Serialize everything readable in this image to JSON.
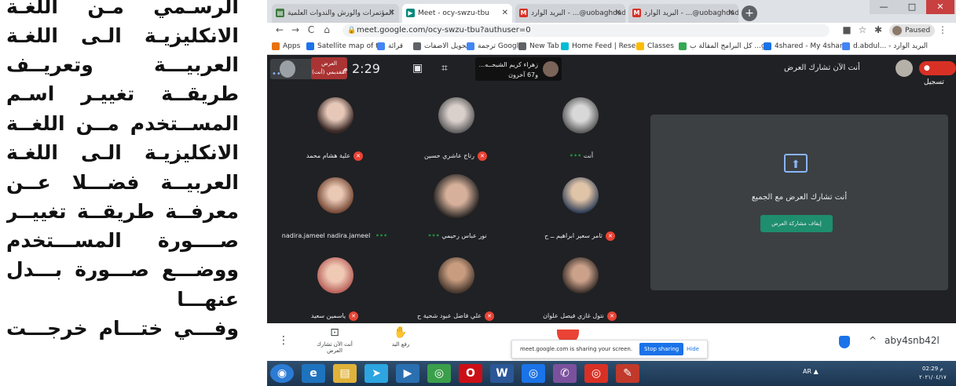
{
  "document": {
    "lines": [
      "الرسـمي مـن اللغـة",
      "الانكليزيـة الـى اللغـة",
      "العربيـــة وتعريــف",
      "طريقــة تغييـر اسـم",
      "المســتخدم مــن اللغــة",
      "الانكليزيـة الـى اللغـة",
      "العربيــة فضـــلا عــن",
      "معرفــة طريقــة تغييــر",
      "صــــورة المســـتخدم",
      "ووضـــع صـــورة بـــدل",
      "عنهـــا",
      "وفـــي ختـــام خرجـــت"
    ]
  },
  "browser": {
    "tabs": [
      {
        "title": "البريد الوارد - ...@uobaghdad.edu.iq",
        "favicon": "gmail-icon",
        "color": "#d93025"
      },
      {
        "title": "البريد الوارد - ...@uobaghdad.edu.iq",
        "favicon": "gmail-icon",
        "color": "#d93025"
      },
      {
        "title": "Meet - ocy-swzu-tbu",
        "favicon": "meet-icon",
        "color": "#00897b"
      },
      {
        "title": "المؤتمرات والورش والندوات العلمية",
        "favicon": "page-icon",
        "color": "#1a73e8"
      }
    ],
    "window_controls": {
      "minimize": "—",
      "maximize": "□",
      "close": "✕"
    },
    "nav": {
      "back": "←",
      "forward": "→",
      "reload": "C",
      "home": "⌂"
    },
    "url": "meet.google.com/ocy-swzu-tbu?authuser=0",
    "paused_label": "Paused",
    "bookmarks": [
      {
        "label": "Apps",
        "color": "#e8710a"
      },
      {
        "label": "Satellite map of the...",
        "color": "#1a73e8"
      },
      {
        "label": "قرائة",
        "color": "#4285f4"
      },
      {
        "label": "تحويل الاضفات",
        "color": "#5f6368"
      },
      {
        "label": "ترجمة Google",
        "color": "#4285f4"
      },
      {
        "label": "New Tab",
        "color": "#5f6368"
      },
      {
        "label": "Home Feed | Resea...",
        "color": "#00bcd4"
      },
      {
        "label": "Classes",
        "color": "#fbbc04"
      },
      {
        "label": "كل البرامج المقالة ب ...gis",
        "color": "#34a853"
      },
      {
        "label": "4shared - My 4shar...",
        "color": "#1a73e8"
      },
      {
        "label": "d.abdul... - البريد الوارد",
        "color": "#4285f4"
      }
    ]
  },
  "meet": {
    "self_tile_label": "أنت",
    "presenting_badge": "العرض التقديمي (أنت)",
    "time": "2:29",
    "time_suffix": "م",
    "speaker": "زهراء كريم الشبحــه... و67 آخرون",
    "you_presenting": "أنت الآن تشارك العرض",
    "record_label": "تسجيل",
    "participants": [
      {
        "name": "أنت",
        "muted": false,
        "speaking": true,
        "photo": "g9"
      },
      {
        "name": "رتاج عاشري حسين",
        "muted": true,
        "speaking": false,
        "photo": "g2"
      },
      {
        "name": "علية هشام محمد",
        "muted": true,
        "speaking": false,
        "photo": "g1"
      },
      {
        "name": "ثامر سعير ابراهيم ــ ح",
        "muted": true,
        "speaking": false,
        "photo": "g3"
      },
      {
        "name": "نور عباس رحيمي",
        "muted": false,
        "speaking": true,
        "photo": "g5"
      },
      {
        "name": "nadira.jameel nadira.jameel",
        "muted": false,
        "speaking": true,
        "photo": "g4"
      },
      {
        "name": "نتول غازي فيصل علوان",
        "muted": true,
        "speaking": false,
        "photo": "g8"
      },
      {
        "name": "علي فاضل عبود شحية ح",
        "muted": true,
        "speaking": false,
        "photo": "g6"
      },
      {
        "name": "ياسمين سعيد",
        "muted": true,
        "speaking": false,
        "photo": "g7"
      }
    ],
    "presentation": {
      "text": "أنت تشارك العرض مع الجميع",
      "button": "إيقاف مشاركة العرض"
    },
    "controls": {
      "more": "⋮",
      "present_label": "أنت الآن تشارك العرض",
      "raise_hand_label": "رفع اليد",
      "meeting_code": "aby4snb42l"
    },
    "share_notice": {
      "text": "meet.google.com is sharing your screen.",
      "stop": "Stop sharing",
      "hide": "Hide"
    }
  },
  "taskbar": {
    "apps": [
      {
        "name": "start-orb-icon",
        "glyph": "◉",
        "color": "#2b7bd4"
      },
      {
        "name": "ie-icon",
        "glyph": "e",
        "color": "#1e73be"
      },
      {
        "name": "folder-icon",
        "glyph": "▤",
        "color": "#e0b23a"
      },
      {
        "name": "telegram-icon",
        "glyph": "➤",
        "color": "#2ca5e0"
      },
      {
        "name": "media-icon",
        "glyph": "▶",
        "color": "#2a6fb0"
      },
      {
        "name": "chrome-icon",
        "glyph": "◎",
        "color": "#3a9f4a"
      },
      {
        "name": "opera-icon",
        "glyph": "O",
        "color": "#cc0f16"
      },
      {
        "name": "word-icon",
        "glyph": "W",
        "color": "#2b5797"
      },
      {
        "name": "app-icon",
        "glyph": "◎",
        "color": "#1a73e8"
      },
      {
        "name": "viber-icon",
        "glyph": "✆",
        "color": "#7b519d"
      },
      {
        "name": "chrome2-icon",
        "glyph": "◎",
        "color": "#d93025"
      },
      {
        "name": "paint-icon",
        "glyph": "✎",
        "color": "#c0392b"
      }
    ],
    "tray": "AR ▲",
    "clock_time": "02:29 م",
    "clock_date": "٢٠٢١/٠٤/١٧"
  }
}
